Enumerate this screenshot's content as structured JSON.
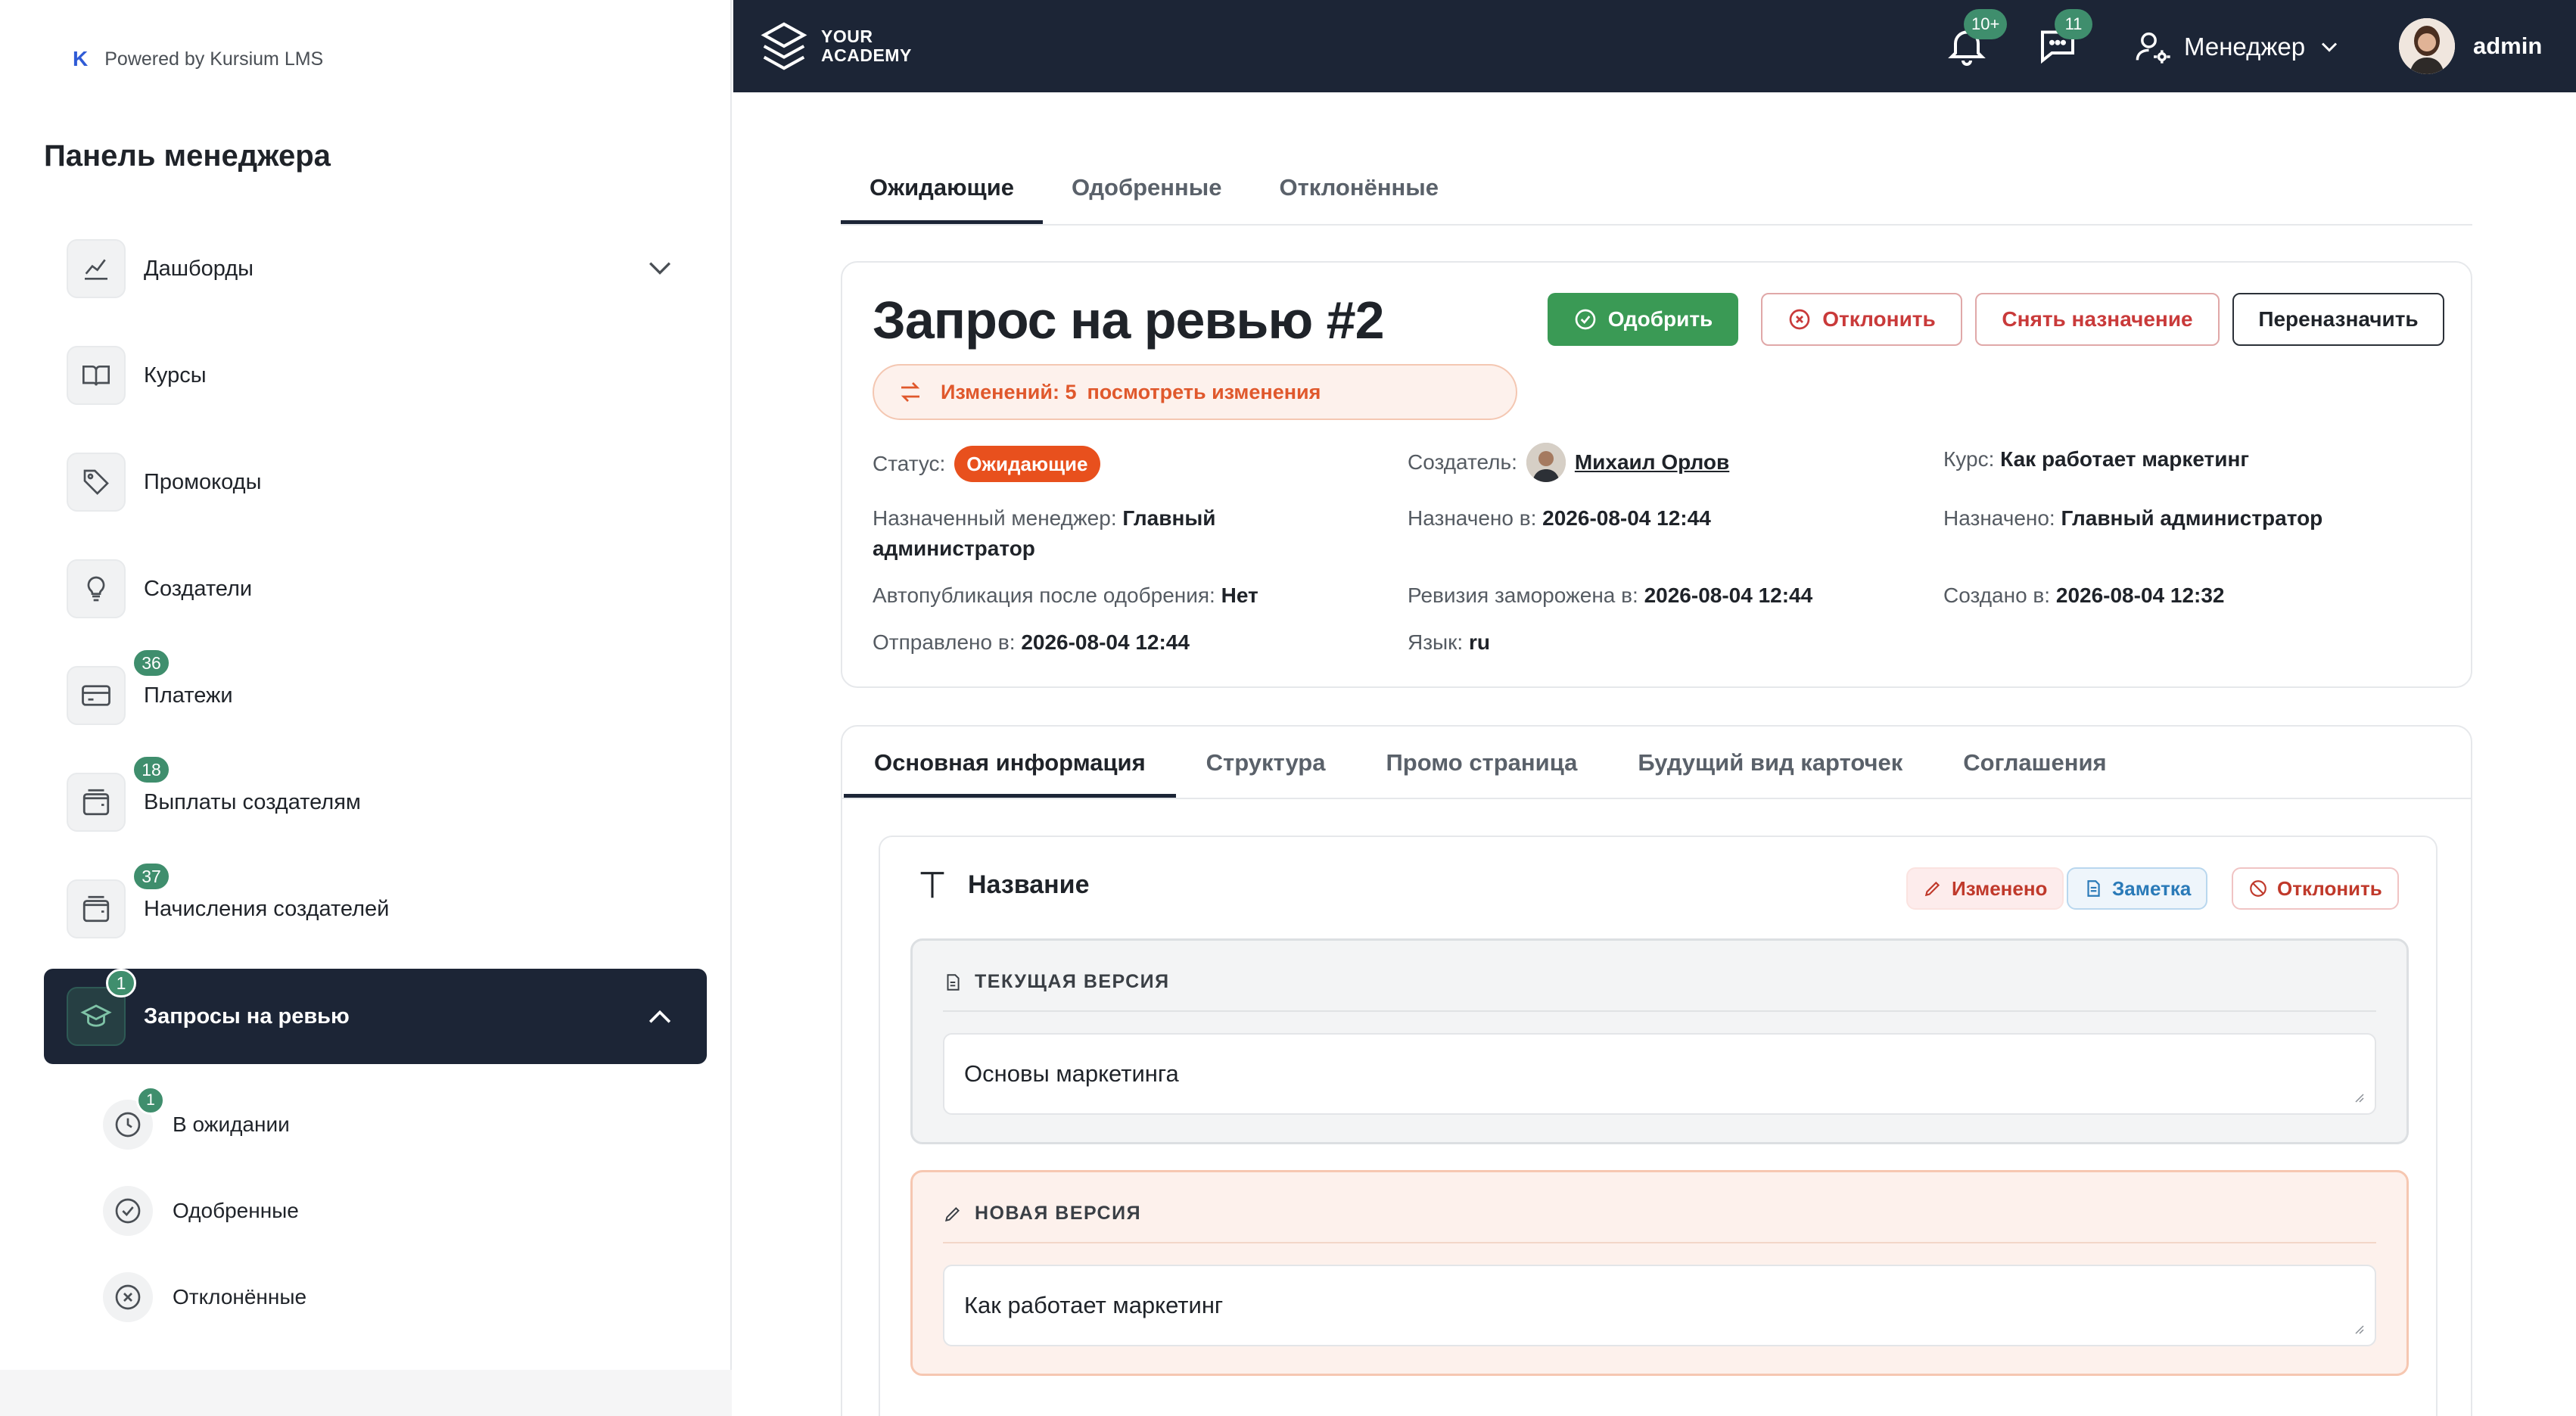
{
  "sidebar": {
    "powered": "Powered by Kursium LMS",
    "title": "Панель менеджера",
    "items": [
      {
        "label": "Дашборды"
      },
      {
        "label": "Курсы"
      },
      {
        "label": "Промокоды"
      },
      {
        "label": "Создатели"
      },
      {
        "label": "Платежи",
        "badge": "36"
      },
      {
        "label": "Выплаты создателям",
        "badge": "18"
      },
      {
        "label": "Начисления создателей",
        "badge": "37"
      },
      {
        "label": "Запросы на ревью",
        "badge": "1"
      }
    ],
    "sub_items": [
      {
        "label": "В ожидании",
        "badge": "1"
      },
      {
        "label": "Одобренные"
      },
      {
        "label": "Отклонённые"
      }
    ]
  },
  "topbar": {
    "brand_line1": "YOUR",
    "brand_line2": "ACADEMY",
    "notifications_badge": "10+",
    "messages_badge": "11",
    "role": "Менеджер",
    "username": "admin"
  },
  "top_tabs": [
    "Ожидающие",
    "Одобренные",
    "Отклонённые"
  ],
  "request": {
    "title": "Запрос на ревью #2",
    "changes_count": "Изменений: 5",
    "changes_link": "посмотреть изменения",
    "buttons": {
      "approve": "Одобрить",
      "reject": "Отклонить",
      "unassign": "Снять назначение",
      "reassign": "Переназначить"
    },
    "status_label": "Статус:",
    "status_value": "Ожидающие",
    "creator_label": "Создатель:",
    "creator_name": "Михаил Орлов",
    "course_label": "Курс:",
    "course_value": "Как работает маркетинг",
    "manager_label": "Назначенный менеджер:",
    "manager_value_1": "Главный",
    "manager_value_2": "администратор",
    "assigned_at_label": "Назначено в:",
    "assigned_at_value": "2026-08-04 12:44",
    "assigned_label": "Назначено:",
    "assigned_value": "Главный администратор",
    "autopub_label": "Автопубликация после одобрения:",
    "autopub_value": "Нет",
    "frozen_label": "Ревизия заморожена в:",
    "frozen_value": "2026-08-04 12:44",
    "created_label": "Создано в:",
    "created_value": "2026-08-04 12:32",
    "sent_label": "Отправлено в:",
    "sent_value": "2026-08-04 12:44",
    "lang_label": "Язык:",
    "lang_value": "ru"
  },
  "detail_tabs": [
    "Основная информация",
    "Структура",
    "Промо страница",
    "Будущий вид карточек",
    "Соглашения"
  ],
  "field": {
    "title": "Название",
    "chip_changed": "Изменено",
    "chip_note": "Заметка",
    "chip_reject": "Отклонить",
    "current_label": "ТЕКУЩАЯ ВЕРСИЯ",
    "current_value": "Основы маркетинга",
    "new_label": "НОВАЯ ВЕРСИЯ",
    "new_value": "Как работает маркетинг"
  },
  "colors": {
    "dark": "#1c2536",
    "accent_green": "#3f8e6d",
    "approve": "#3a9a55",
    "status_orange": "#e8501d",
    "danger": "#c93a3a"
  }
}
